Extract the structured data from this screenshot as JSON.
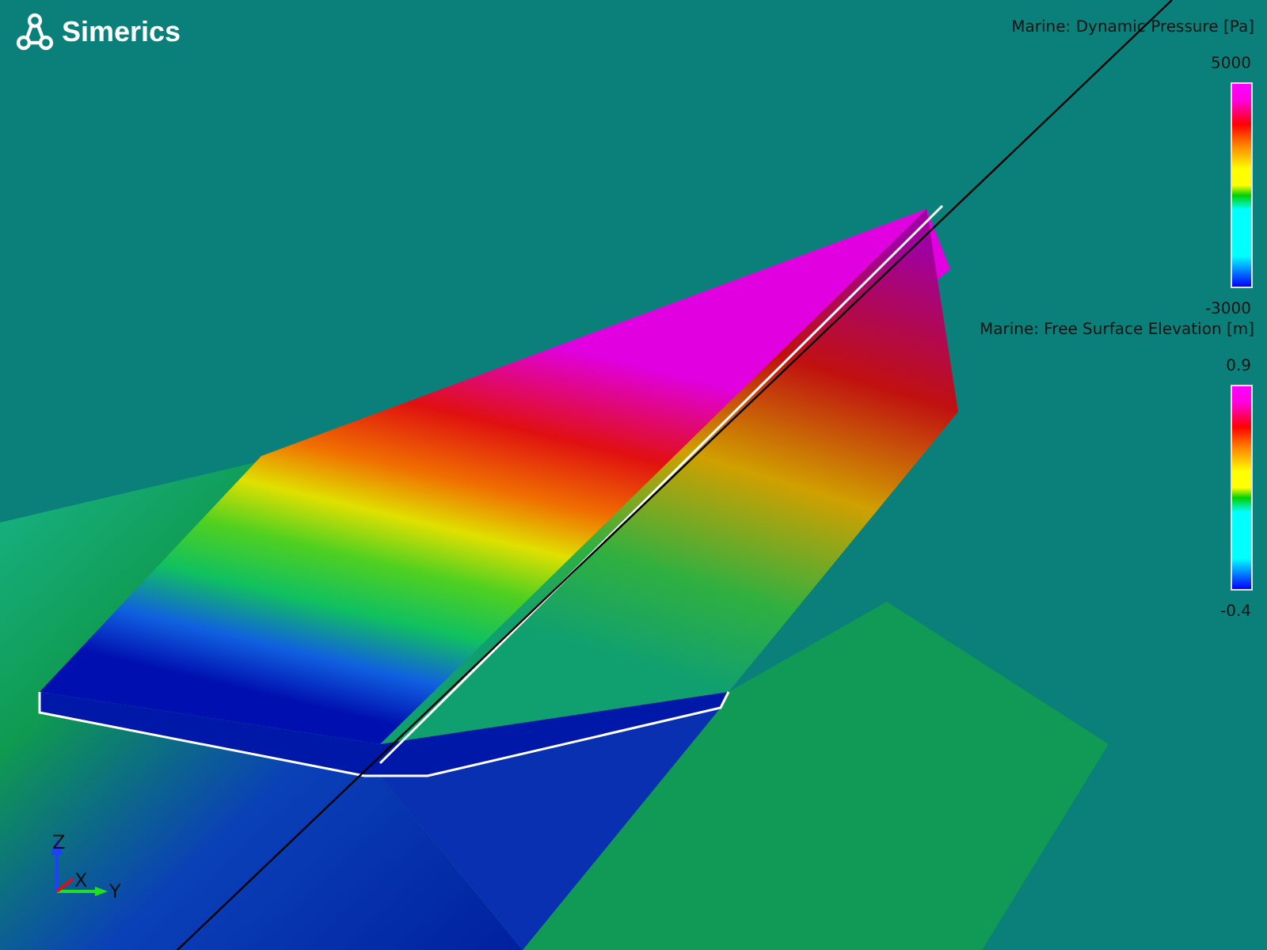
{
  "logo": {
    "name": "Simerics"
  },
  "legends": [
    {
      "title": "Marine: Dynamic Pressure [Pa]",
      "max": "5000",
      "min": "-3000"
    },
    {
      "title": "Marine: Free Surface Elevation [m]",
      "max": "0.9",
      "min": "-0.4"
    }
  ],
  "axes": [
    {
      "label": "Z"
    },
    {
      "label": "X"
    },
    {
      "label": "Y"
    }
  ]
}
